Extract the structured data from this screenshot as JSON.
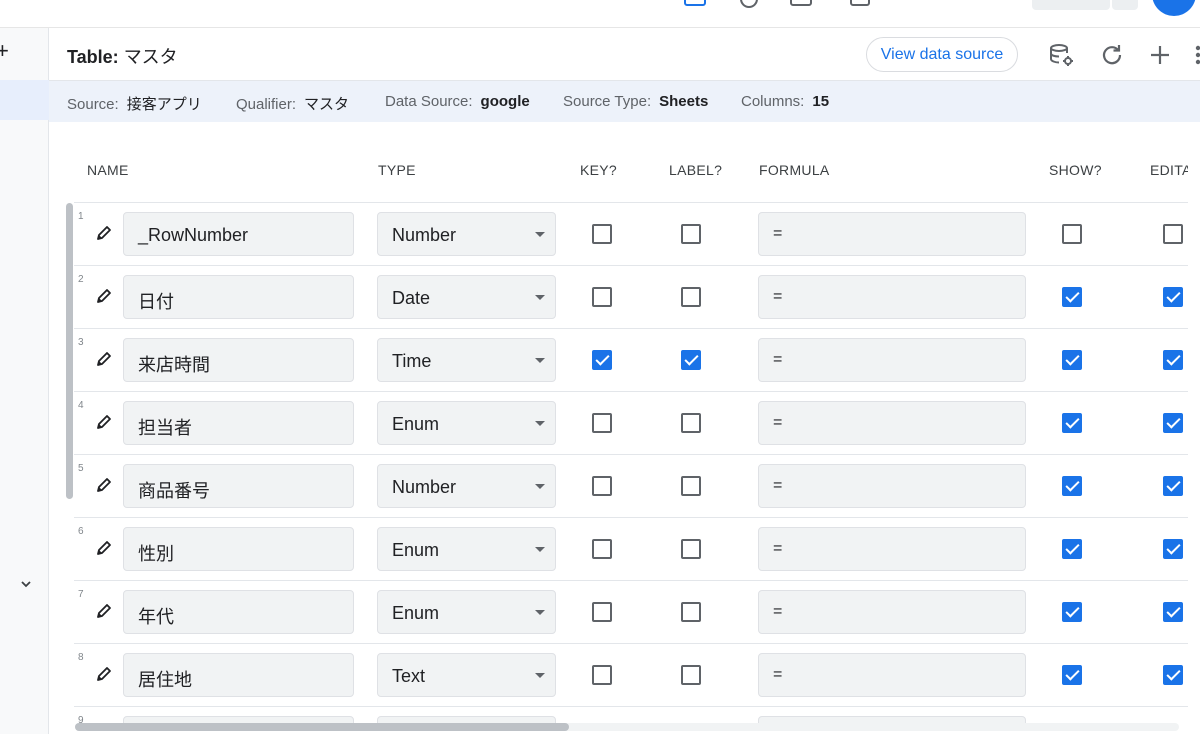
{
  "header": {
    "title_prefix": "Table:",
    "title_name": "マスタ",
    "view_source_label": "View data source"
  },
  "info": {
    "source_label": "Source:",
    "source_value": "接客アプリ",
    "qualifier_label": "Qualifier:",
    "qualifier_value": "マスタ",
    "data_source_label": "Data Source:",
    "data_source_value": "google",
    "source_type_label": "Source Type:",
    "source_type_value": "Sheets",
    "columns_label": "Columns:",
    "columns_value": "15"
  },
  "columns": {
    "name": "NAME",
    "type": "TYPE",
    "key": "KEY?",
    "label": "LABEL?",
    "formula": "FORMULA",
    "show": "SHOW?",
    "edit": "EDITA"
  },
  "rows": [
    {
      "num": "1",
      "name": "_RowNumber",
      "type": "Number",
      "key": false,
      "label": false,
      "formula": "=",
      "show": false,
      "edit": false
    },
    {
      "num": "2",
      "name": "日付",
      "type": "Date",
      "key": false,
      "label": false,
      "formula": "=",
      "show": true,
      "edit": true
    },
    {
      "num": "3",
      "name": "来店時間",
      "type": "Time",
      "key": true,
      "label": true,
      "formula": "=",
      "show": true,
      "edit": true
    },
    {
      "num": "4",
      "name": "担当者",
      "type": "Enum",
      "key": false,
      "label": false,
      "formula": "=",
      "show": true,
      "edit": true
    },
    {
      "num": "5",
      "name": "商品番号",
      "type": "Number",
      "key": false,
      "label": false,
      "formula": "=",
      "show": true,
      "edit": true
    },
    {
      "num": "6",
      "name": "性別",
      "type": "Enum",
      "key": false,
      "label": false,
      "formula": "=",
      "show": true,
      "edit": true
    },
    {
      "num": "7",
      "name": "年代",
      "type": "Enum",
      "key": false,
      "label": false,
      "formula": "=",
      "show": true,
      "edit": true
    },
    {
      "num": "8",
      "name": "居住地",
      "type": "Text",
      "key": false,
      "label": false,
      "formula": "=",
      "show": true,
      "edit": true
    },
    {
      "num": "9",
      "name": "",
      "type": "",
      "key": false,
      "label": false,
      "formula": "",
      "show": false,
      "edit": false
    }
  ],
  "icons": {
    "pencil": "pencil-icon",
    "db_settings": "database-settings-icon",
    "refresh": "refresh-icon",
    "add": "plus-icon",
    "more": "more-vert-icon"
  },
  "colors": {
    "accent": "#1a73e8",
    "infobar": "#edf2fa"
  }
}
